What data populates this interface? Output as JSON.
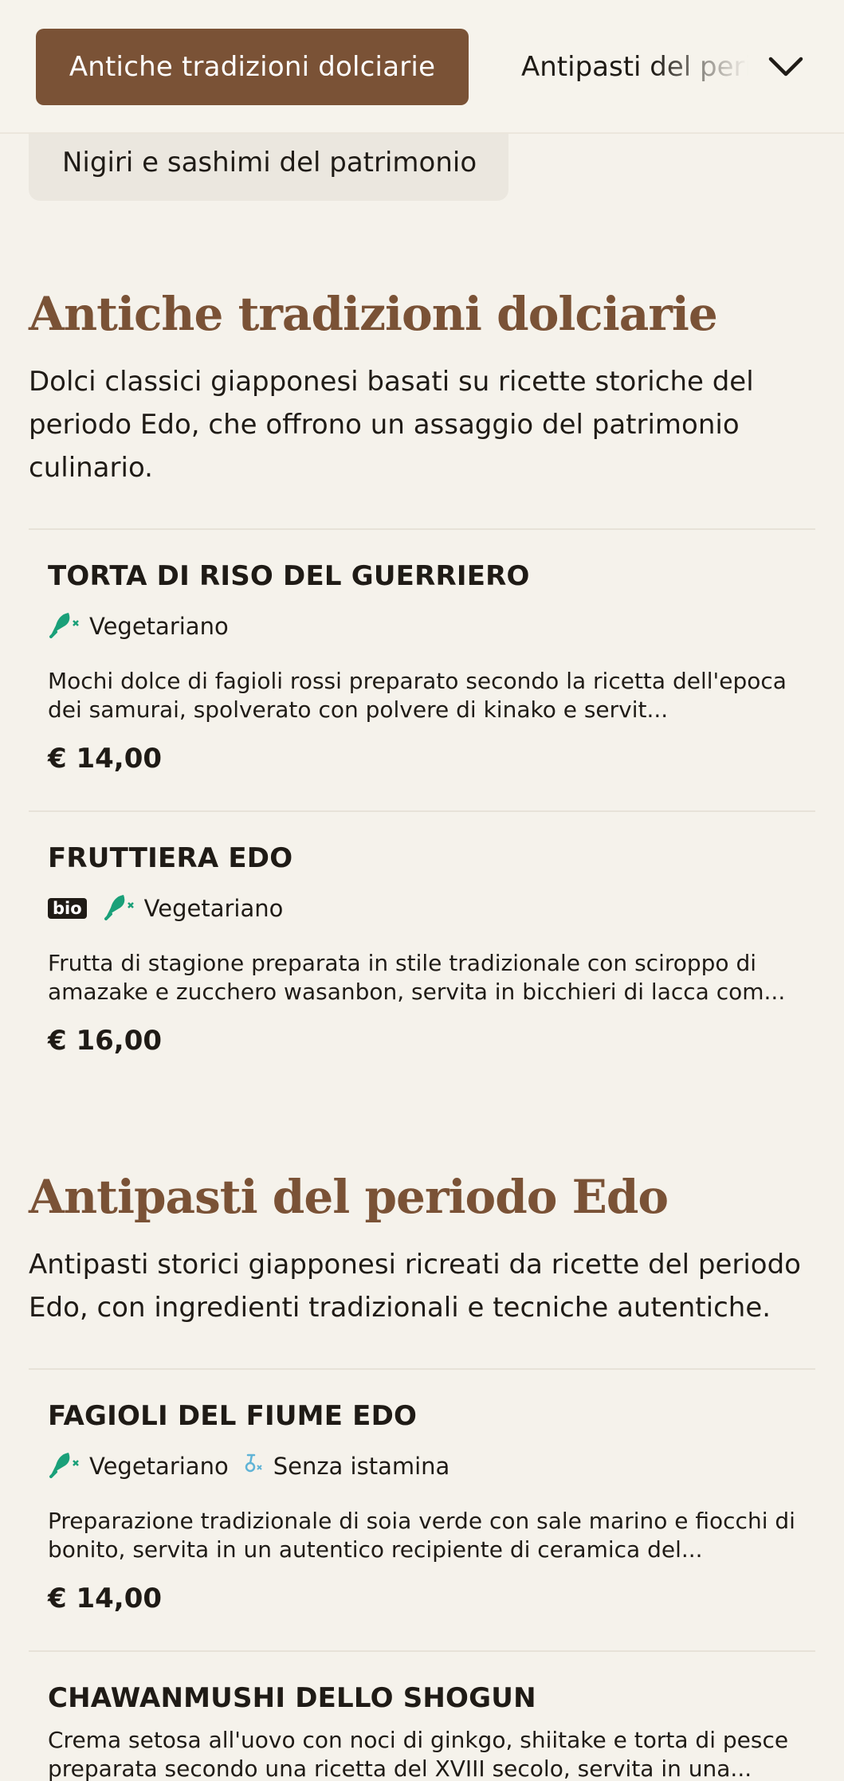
{
  "nav": {
    "active_label": "Antiche tradizioni dolciarie",
    "next_label": "Antipasti del periodo Edo",
    "previous_chip": "Nigiri e sashimi del patrimonio"
  },
  "sections": [
    {
      "title": "Antiche tradizioni dolciarie",
      "description": "Dolci classici giapponesi basati su ricette storiche del periodo Edo, che offrono un assaggio del patrimonio culinario.",
      "items": [
        {
          "name": "TORTA DI RISO DEL GUERRIERO",
          "tags": [
            "Vegetariano"
          ],
          "description": "Mochi dolce di fagioli rossi preparato secondo la ricetta dell'epoca dei samurai, spolverato con polvere di kinako e servit...",
          "price": "€ 14,00"
        },
        {
          "name": "FRUTTIERA EDO",
          "badge": "bio",
          "tags": [
            "Vegetariano"
          ],
          "description": "Frutta di stagione preparata in stile tradizionale con sciroppo di amazake e zucchero wasanbon, servita in bicchieri di lacca com...",
          "price": "€ 16,00"
        }
      ]
    },
    {
      "title": "Antipasti del periodo Edo",
      "description": "Antipasti storici giapponesi ricreati da ricette del periodo Edo, con ingredienti tradizionali e tecniche autentiche.",
      "items": [
        {
          "name": "FAGIOLI DEL FIUME EDO",
          "tags": [
            "Vegetariano",
            "Senza istamina"
          ],
          "description": "Preparazione tradizionale di soia verde con sale marino e fiocchi di bonito, servita in un autentico recipiente di ceramica del...",
          "price": "€ 14,00"
        },
        {
          "name": "CHAWANMUSHI DELLO SHOGUN",
          "description": "Crema setosa all'uovo con noci di ginkgo, shiitake e torta di pesce preparata secondo una ricetta del XVIII secolo, servita in una..."
        }
      ]
    }
  ],
  "colors": {
    "accent": "#7a5236",
    "tag_green": "#1aa079",
    "tag_blue": "#5fb3d6"
  }
}
